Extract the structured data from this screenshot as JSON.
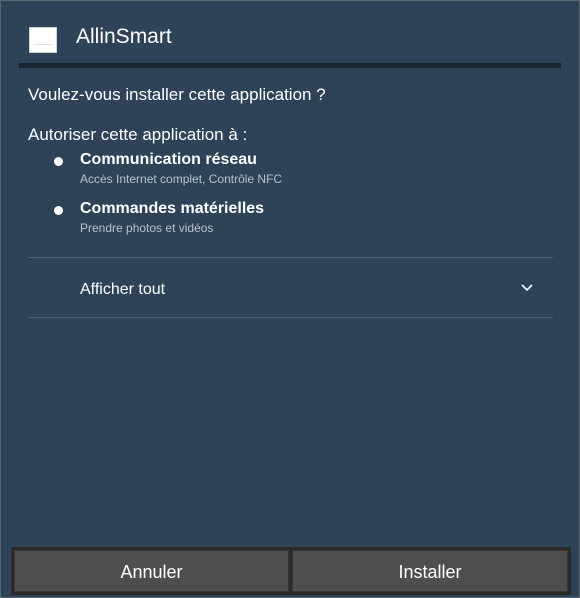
{
  "dialog": {
    "app_name": "AllinSmart",
    "question": "Voulez-vous installer cette application ?",
    "permissions_heading": "Autoriser cette application à :",
    "permissions": [
      {
        "title": "Communication réseau",
        "description": "Accès Internet complet, Contrôle NFC"
      },
      {
        "title": "Commandes matérielles",
        "description": "Prendre photos et vidéos"
      }
    ],
    "show_all_label": "Afficher tout"
  },
  "buttons": {
    "cancel_label": "Annuler",
    "install_label": "Installer"
  },
  "colors": {
    "dialog_background": "#2e4357",
    "button_background": "#4e4e4e",
    "secondary_text": "#b7c2cc"
  },
  "icons": {
    "app": "app-icon",
    "bullet": "bullet",
    "expand": "chevron-down-icon"
  }
}
